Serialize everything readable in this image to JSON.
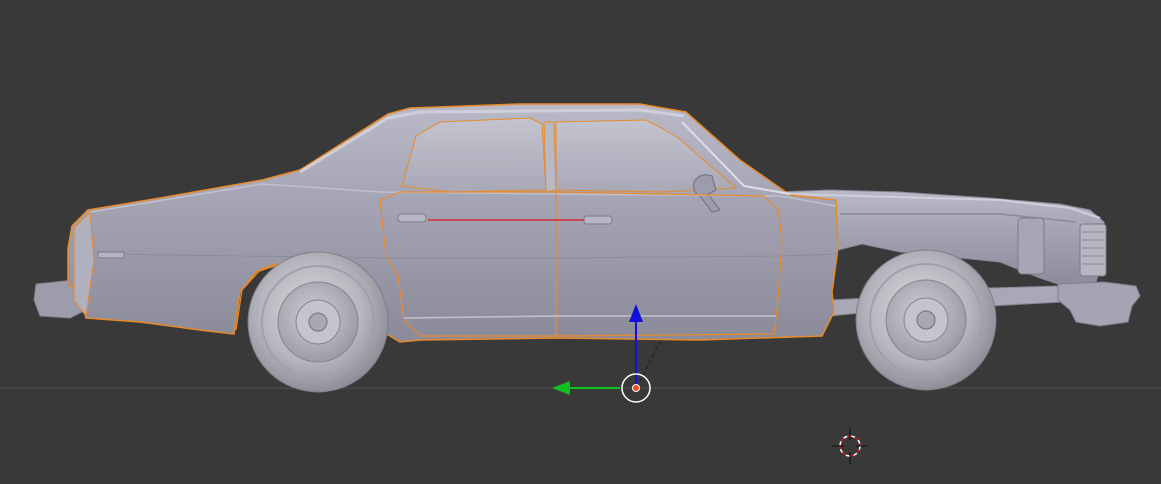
{
  "viewport": {
    "background": "#393939",
    "ground_line_color": "#505050",
    "view": "side-orthographic"
  },
  "selected_object": {
    "type": "car-body-mesh",
    "selection_outline_color": "#e98a2a",
    "body_color": "#a3a3b3",
    "wheel_color": "#b8b8c0"
  },
  "manipulator": {
    "z_axis_color": "#1010d8",
    "y_axis_color": "#10c020",
    "pivot_color": "#e2521c",
    "ring_color": "#ffffff"
  },
  "red_axis_line_color": "#e01515",
  "cursor_3d": {
    "icon": "crosshair-3d-cursor-icon",
    "ring_colors": [
      "#ffffff",
      "#d01010"
    ]
  }
}
